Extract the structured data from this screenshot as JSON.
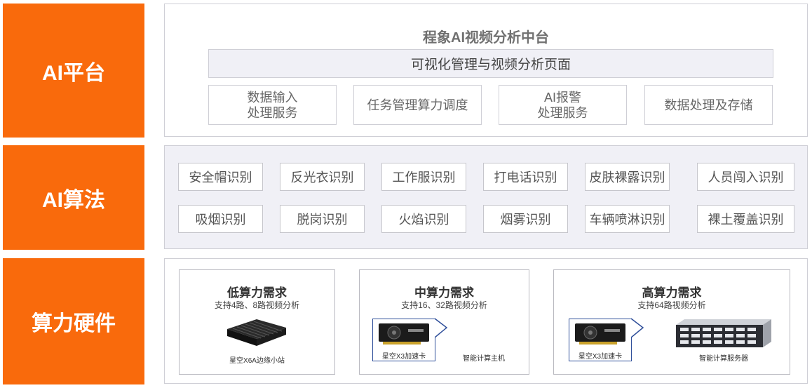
{
  "rows": {
    "platform": "AI平台",
    "algorithm": "AI算法",
    "hardware": "算力硬件"
  },
  "platform": {
    "title": "程象AI视频分析中台",
    "visual_bar": "可视化管理与视频分析页面",
    "services": [
      "数据输入\n处理服务",
      "任务管理算力调度",
      "AI报警\n处理服务",
      "数据处理及存储"
    ]
  },
  "algorithms": [
    "安全帽识别",
    "反光衣识别",
    "工作服识别",
    "打电话识别",
    "皮肤裸露识别",
    "人员闯入识别",
    "吸烟识别",
    "脱岗识别",
    "火焰识别",
    "烟雾识别",
    "车辆喷淋识别",
    "裸土覆盖识别"
  ],
  "hardware": {
    "low": {
      "title": "低算力需求",
      "subtitle": "支持4路、8路视频分析",
      "device_caption": "星空X6A边缘小站"
    },
    "mid": {
      "title": "中算力需求",
      "subtitle": "支持16、32路视频分析",
      "card_caption": "星空X3加速卡",
      "host_caption": "智能计算主机"
    },
    "high": {
      "title": "高算力需求",
      "subtitle": "支持64路视频分析",
      "card_caption": "星空X3加速卡",
      "host_caption": "智能计算服务器"
    }
  },
  "colors": {
    "accent": "#f96a0c",
    "panel_border": "#cfcfd6",
    "panel_fill": "#f0f0f6",
    "card_frame": "#2f4f9a"
  }
}
